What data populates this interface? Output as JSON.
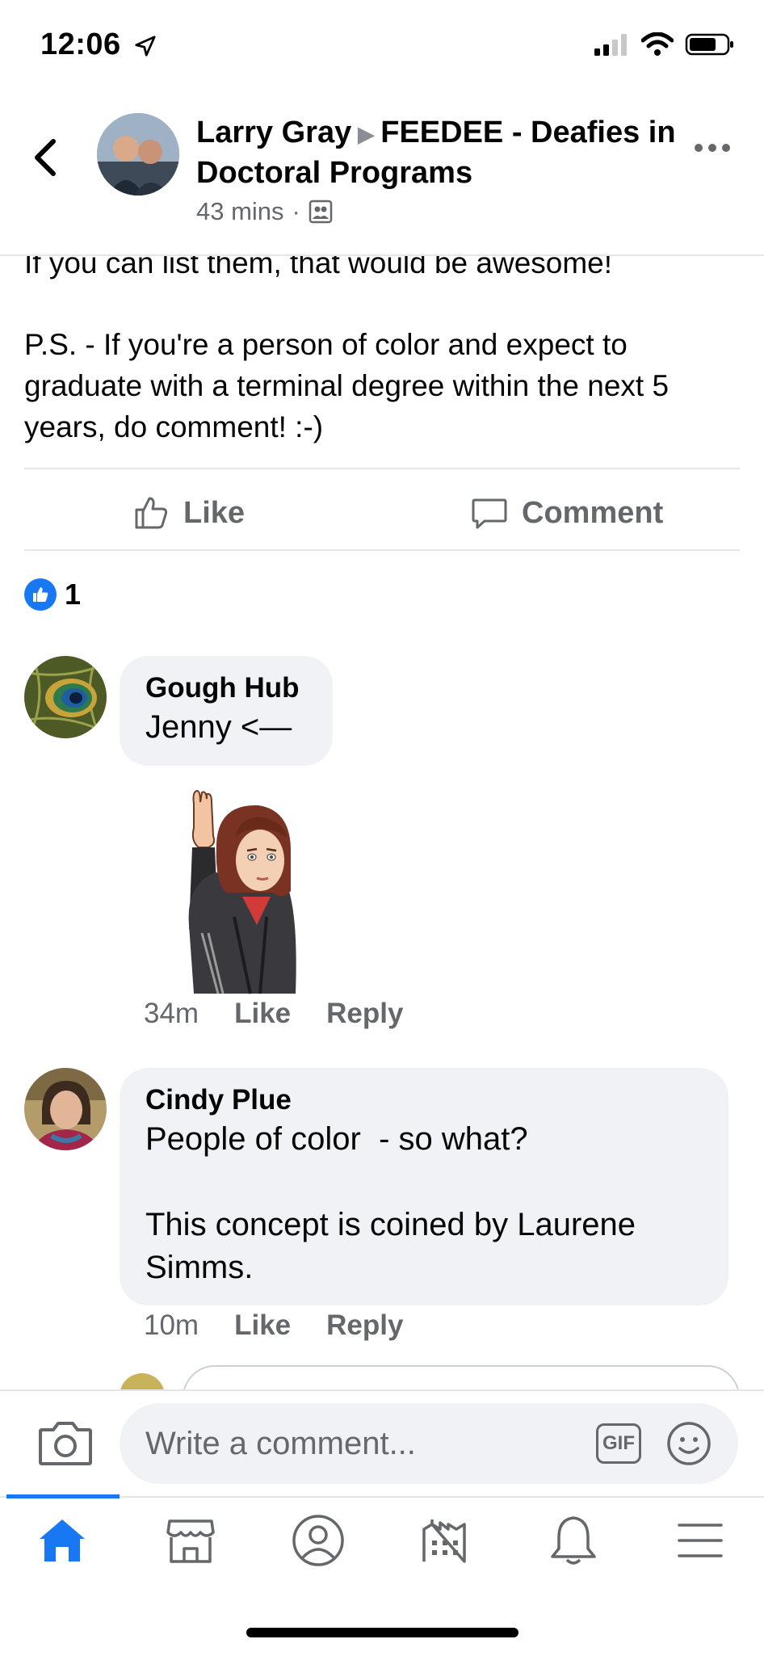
{
  "status_bar": {
    "time": "12:06"
  },
  "header": {
    "author": "Larry Gray",
    "group": "FEEDEE - Deafies in Doctoral Programs",
    "time": "43 mins",
    "separator": "·"
  },
  "post": {
    "paragraphs": [
      "If you can list them, that would be awesome!",
      "P.S. - If you're a person of color and expect to graduate with a terminal degree within the next 5 years, do comment!  :-)"
    ],
    "like_label": "Like",
    "comment_label": "Comment",
    "reaction_count": "1"
  },
  "comments": [
    {
      "name": "Gough Hub",
      "text": "Jenny <—",
      "time": "34m",
      "like": "Like",
      "reply": "Reply"
    },
    {
      "name": "Cindy Plue",
      "text": "People of color  - so what?\n\nThis concept is coined by Laurene Simms.",
      "time": "10m",
      "like": "Like",
      "reply": "Reply"
    }
  ],
  "composer": {
    "placeholder": "Write a comment...",
    "gif_label": "GIF"
  },
  "colors": {
    "accent": "#1877f2",
    "bubble": "#f0f2f5",
    "muted": "#65676b"
  },
  "tabs": [
    "home-icon",
    "marketplace-icon",
    "profile-icon",
    "pages-icon",
    "notifications-icon",
    "menu-icon"
  ]
}
